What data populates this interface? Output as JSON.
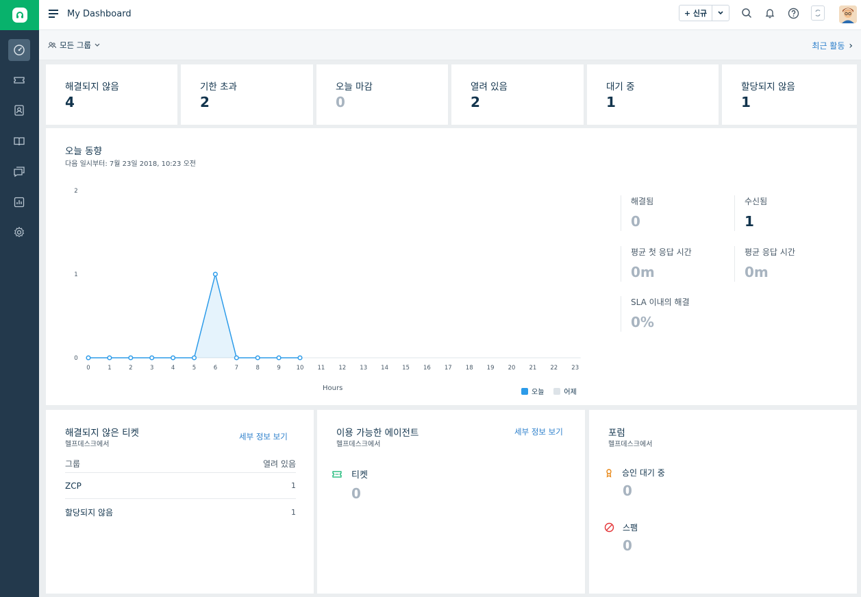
{
  "header": {
    "title": "My Dashboard",
    "new_label": "+ 신규"
  },
  "subheader": {
    "group_label": "모든 그룹",
    "recent_label": "최근 활동",
    "recent_arrow": "›"
  },
  "stats": [
    {
      "label": "해결되지 않음",
      "value": "4",
      "muted": false
    },
    {
      "label": "기한 초과",
      "value": "2",
      "muted": false
    },
    {
      "label": "오늘 마감",
      "value": "0",
      "muted": true
    },
    {
      "label": "열려 있음",
      "value": "2",
      "muted": false
    },
    {
      "label": "대기 중",
      "value": "1",
      "muted": false
    },
    {
      "label": "할당되지 않음",
      "value": "1",
      "muted": false
    }
  ],
  "trend": {
    "title": "오늘 동향",
    "subtitle": "다음 일시부터: 7월 23일 2018, 10:23 오전",
    "xlabel": "Hours",
    "legend_today": "오늘",
    "legend_yesterday": "어제"
  },
  "chart_data": {
    "type": "area",
    "x": [
      0,
      1,
      2,
      3,
      4,
      5,
      6,
      7,
      8,
      9,
      10,
      11,
      12,
      13,
      14,
      15,
      16,
      17,
      18,
      19,
      20,
      21,
      22,
      23
    ],
    "xlabel": "Hours",
    "ylabel": "",
    "ylim": [
      0,
      2
    ],
    "yticks": [
      0,
      1,
      2
    ],
    "series": [
      {
        "name": "오늘",
        "color": "#2c9be9",
        "x": [
          0,
          1,
          2,
          3,
          4,
          5,
          6,
          7,
          8,
          9,
          10
        ],
        "values": [
          0,
          0,
          0,
          0,
          0,
          0,
          1,
          0,
          0,
          0,
          0
        ]
      },
      {
        "name": "어제",
        "color": "#dde3e8",
        "x": [],
        "values": []
      }
    ],
    "legend_position": "bottom-right",
    "grid": false
  },
  "metrics": {
    "resolved": {
      "label": "해결됨",
      "value": "0"
    },
    "received": {
      "label": "수신됨",
      "value": "1"
    },
    "first_response": {
      "label": "평균 첫 응답 시간",
      "value": "0m"
    },
    "avg_response": {
      "label": "평균 응답 시간",
      "value": "0m"
    },
    "sla": {
      "label": "SLA 이내의 해결",
      "value": "0%"
    }
  },
  "unresolved_panel": {
    "title": "해결되지 않은 티켓",
    "subtitle": "헬프데스크에서",
    "link": "세부 정보 보기",
    "col_group": "그룹",
    "col_open": "열려 있음",
    "rows": [
      {
        "group": "ZCP",
        "count": "1"
      },
      {
        "group": "할당되지 않음",
        "count": "1"
      }
    ]
  },
  "agents_panel": {
    "title": "이용 가능한 에이전트",
    "subtitle": "헬프데스크에서",
    "link": "세부 정보 보기",
    "ticket_label": "티켓",
    "ticket_value": "0"
  },
  "forum_panel": {
    "title": "포럼",
    "subtitle": "헬프데스크에서",
    "pending_label": "승인 대기 중",
    "pending_value": "0",
    "spam_label": "스팸",
    "spam_value": "0"
  },
  "colors": {
    "brand": "#08b26c",
    "sidebar": "#23394c",
    "link": "#2c7fcb",
    "line": "#2c9be9"
  }
}
